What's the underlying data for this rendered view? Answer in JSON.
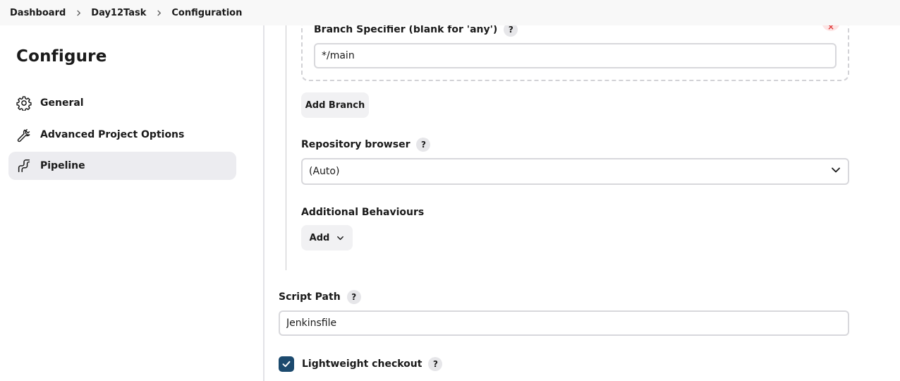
{
  "breadcrumb": {
    "items": [
      "Dashboard",
      "Day12Task",
      "Configuration"
    ]
  },
  "sidebar": {
    "title": "Configure",
    "items": [
      {
        "label": "General",
        "icon": "gear-icon"
      },
      {
        "label": "Advanced Project Options",
        "icon": "wrench-icon"
      },
      {
        "label": "Pipeline",
        "icon": "pipeline-icon",
        "active": true
      }
    ]
  },
  "branch": {
    "specifier_label": "Branch Specifier (blank for 'any')",
    "specifier_value": "*/main",
    "delete_label": "×",
    "add_branch_label": "Add Branch"
  },
  "repo_browser": {
    "label": "Repository browser",
    "selected": "(Auto)"
  },
  "behaviours": {
    "label": "Additional Behaviours",
    "add_label": "Add"
  },
  "script_path": {
    "label": "Script Path",
    "value": "Jenkinsfile"
  },
  "lightweight": {
    "label": "Lightweight checkout",
    "checked": true
  },
  "help_glyph": "?",
  "colors": {
    "accent": "#1c4a6e",
    "active_bg": "#ececf0",
    "delete_bg": "#fde4e4"
  }
}
